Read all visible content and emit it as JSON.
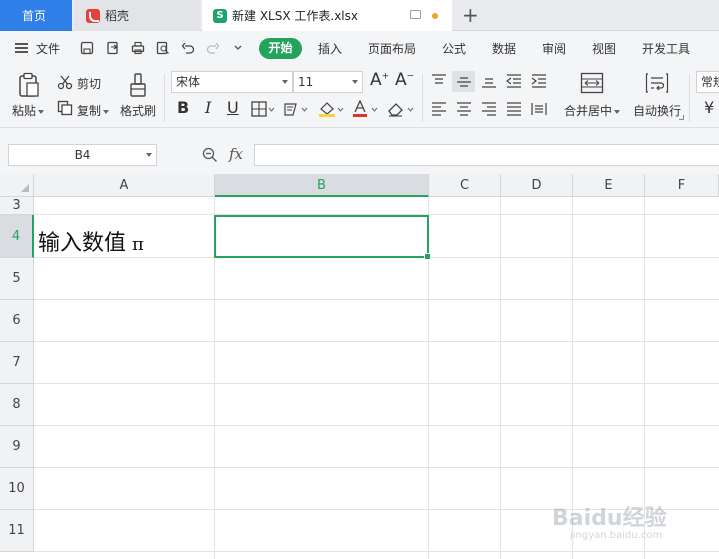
{
  "tabs": {
    "home": "首页",
    "daoke": "稻壳",
    "file": "新建 XLSX 工作表.xlsx"
  },
  "menu": {
    "file": "文件",
    "items": [
      "开始",
      "插入",
      "页面布局",
      "公式",
      "数据",
      "审阅",
      "视图",
      "开发工具"
    ]
  },
  "ribbon": {
    "paste": "粘贴",
    "cut": "剪切",
    "copy": "复制",
    "format_painter": "格式刷",
    "font_name": "宋体",
    "font_size": "11",
    "bold": "B",
    "italic": "I",
    "underline": "U",
    "merge_center": "合并居中",
    "wrap_text": "自动换行",
    "number_format": "常规",
    "currency_symbol": "¥"
  },
  "formula_bar": {
    "name_box": "B4",
    "fx": "fx",
    "value": ""
  },
  "grid": {
    "columns": [
      "A",
      "B",
      "C",
      "D",
      "E",
      "F"
    ],
    "rows": [
      "3",
      "4",
      "5",
      "6",
      "7",
      "8",
      "9",
      "10",
      "11"
    ],
    "active_cell": "B4",
    "cell_a4": "输入数值",
    "cell_a4_symbol": "π"
  },
  "watermark": {
    "brand": "Baidu经验",
    "url": "jingyan.baidu.com"
  },
  "colors": {
    "accent_green": "#23a35c",
    "home_tab_blue": "#2f7fe8",
    "daoke_red": "#e8413c"
  }
}
